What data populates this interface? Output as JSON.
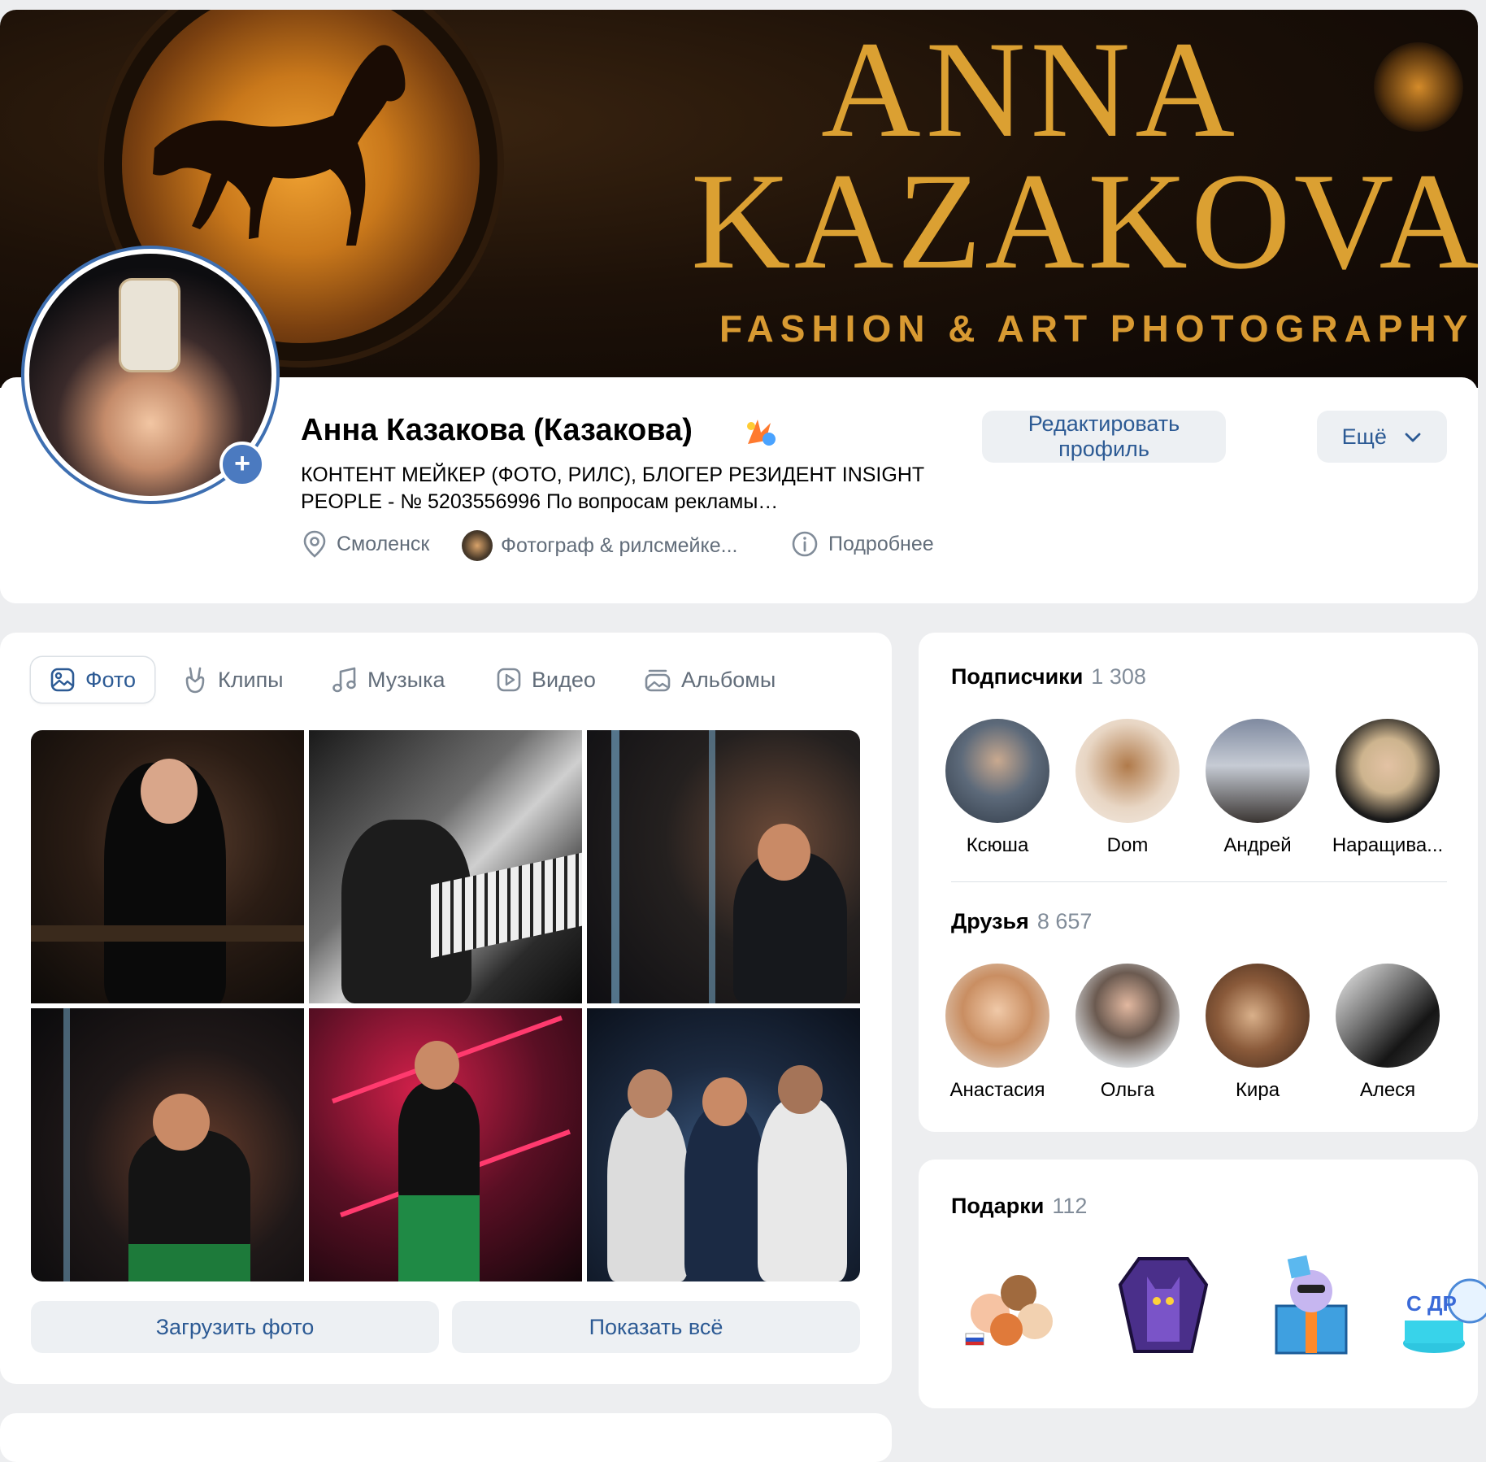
{
  "cover": {
    "title_line1": "ANNA",
    "title_line2": "KAZAKOVA",
    "subtitle": "FASHION & ART PHOTOGRAPHY"
  },
  "profile": {
    "name": "Анна Казакова (Казакова)",
    "status": "КОНТЕНТ МЕЙКЕР (ФОТО, РИЛС), БЛОГЕР РЕЗИДЕНТ INSIGHT PEOPLE - № 5203556996 По вопросам рекламы…",
    "city": "Смоленск",
    "work": "Фотограф & рилсмейке...",
    "more_info": "Подробнее",
    "edit_button": "Редактировать профиль",
    "more_button": "Ещё",
    "add_photo_symbol": "+"
  },
  "media_tabs": [
    {
      "label": "Фото",
      "icon": "image-icon",
      "active": true
    },
    {
      "label": "Клипы",
      "icon": "clips-hand-icon",
      "active": false
    },
    {
      "label": "Музыка",
      "icon": "music-note-icon",
      "active": false
    },
    {
      "label": "Видео",
      "icon": "video-play-icon",
      "active": false
    },
    {
      "label": "Альбомы",
      "icon": "albums-icon",
      "active": false
    }
  ],
  "media_buttons": {
    "upload": "Загрузить фото",
    "show_all": "Показать всё"
  },
  "followers": {
    "title": "Подписчики",
    "count": "1 308",
    "people": [
      "Ксюша",
      "Dom",
      "Андрей",
      "Наращива..."
    ]
  },
  "friends": {
    "title": "Друзья",
    "count": "8 657",
    "people": [
      "Анастасия",
      "Ольга",
      "Кира",
      "Алеся"
    ]
  },
  "gifts": {
    "title": "Подарки",
    "count": "112"
  },
  "colors": {
    "accent": "#2c5a94",
    "secondary_text": "#626d7a",
    "button_bg": "#edf0f3",
    "page_bg": "#edeef0",
    "cover_gold": "#dba032"
  }
}
